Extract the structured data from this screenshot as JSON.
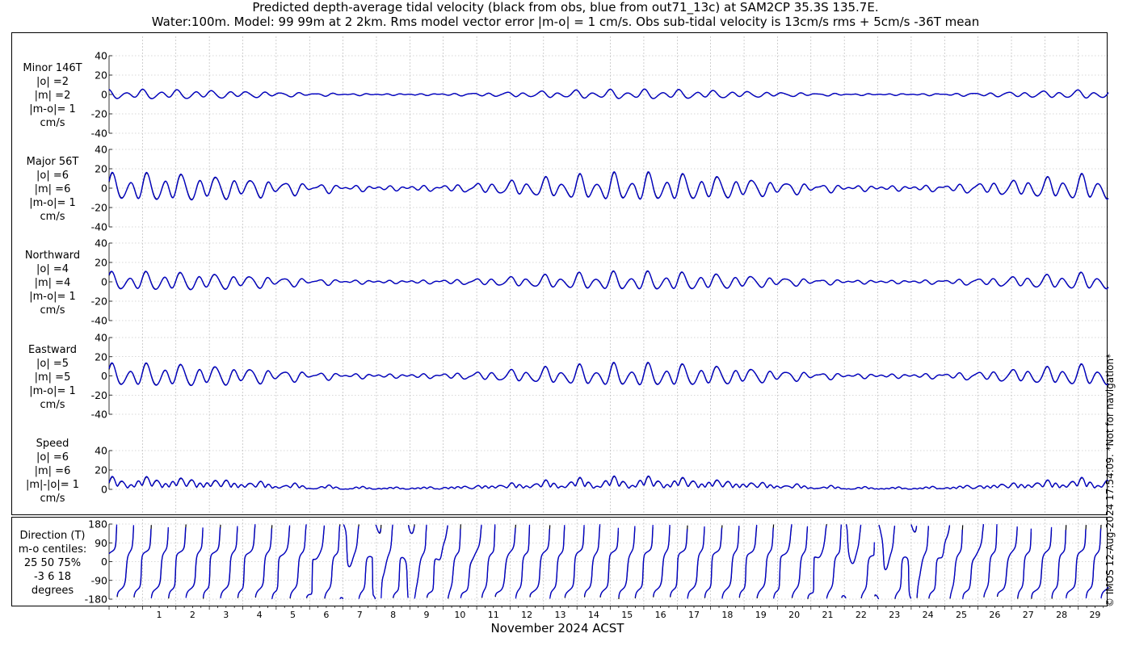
{
  "title_line1": "Predicted depth-average tidal velocity (black from obs, blue from out71_13c) at SAM2CP 35.3S 135.7E.",
  "title_line2": "Water:100m. Model: 99 99m at 2 2km. Rms model vector error |m-o| = 1 cm/s. Obs sub-tidal velocity is 13cm/s rms + 5cm/s -36T mean",
  "footer_note": "© IMOS 12-Aug-2024 17:54:09. *Not for navigation*",
  "xlabel": "November 2024 ACST",
  "colors": {
    "obs": "#000000",
    "model": "#0000cc",
    "grid": "#b0b0b0"
  },
  "chart_data": {
    "type": "line",
    "x_day_ticks": [
      "1",
      "2",
      "3",
      "4",
      "5",
      "6",
      "7",
      "8",
      "9",
      "10",
      "11",
      "12",
      "13",
      "14",
      "15",
      "16",
      "17",
      "18",
      "19",
      "20",
      "21",
      "22",
      "23",
      "24",
      "25",
      "26",
      "27",
      "28",
      "29"
    ],
    "x_range_days": [
      0.0,
      29.9
    ],
    "series_legend": [
      "black from obs",
      "blue from out71_13c"
    ],
    "panels": [
      {
        "id": "minor",
        "label_lines": [
          "Minor 146T",
          "|o| =2",
          "|m| =2",
          "|m-o|= 1",
          "cm/s"
        ],
        "yticks": [
          "40",
          "20",
          "0",
          "-20",
          "-40"
        ],
        "ylim": [
          -40,
          40
        ],
        "amplitude": 2
      },
      {
        "id": "major",
        "label_lines": [
          "Major 56T",
          "|o| =6",
          "|m| =6",
          "|m-o|= 1",
          "cm/s"
        ],
        "yticks": [
          "40",
          "20",
          "0",
          "-20",
          "-40"
        ],
        "ylim": [
          -40,
          40
        ],
        "amplitude": 6
      },
      {
        "id": "north",
        "label_lines": [
          "Northward",
          "|o| =4",
          "|m| =4",
          "|m-o|= 1",
          "cm/s"
        ],
        "yticks": [
          "40",
          "20",
          "0",
          "-20",
          "-40"
        ],
        "ylim": [
          -40,
          40
        ],
        "amplitude": 4
      },
      {
        "id": "east",
        "label_lines": [
          "Eastward",
          "|o| =5",
          "|m| =5",
          "|m-o|= 1",
          "cm/s"
        ],
        "yticks": [
          "40",
          "20",
          "0",
          "-20",
          "-40"
        ],
        "ylim": [
          -40,
          40
        ],
        "amplitude": 5
      },
      {
        "id": "speed",
        "label_lines": [
          "Speed",
          "|o| =6",
          "|m| =6",
          "|m|-|o|= 1",
          "cm/s"
        ],
        "yticks": [
          "40",
          "20",
          "0"
        ],
        "ylim": [
          0,
          40
        ],
        "amplitude": 6
      },
      {
        "id": "direction",
        "label_lines": [
          "Direction (T)",
          "m-o centiles:",
          "25  50  75%",
          "-3   6  18",
          "degrees"
        ],
        "yticks": [
          "180",
          "90",
          "0",
          "-90",
          "-180"
        ],
        "ylim": [
          -180,
          180
        ]
      }
    ]
  }
}
